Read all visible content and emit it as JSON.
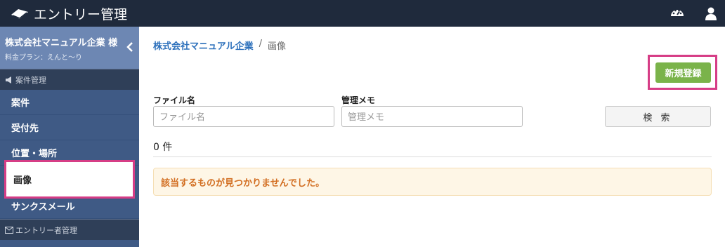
{
  "header": {
    "title": "エントリー管理",
    "dashboard_icon": "speedometer-icon",
    "user_icon": "user-icon"
  },
  "sidebar": {
    "account_name": "株式会社マニュアル企業 様",
    "plan": "料金プラン：えんと〜り",
    "sections": [
      {
        "label": "案件管理",
        "icon": "megaphone-icon"
      },
      {
        "label": "エントリー者管理",
        "icon": "mail-icon"
      }
    ],
    "items": [
      "案件",
      "受付先",
      "位置・場所",
      "画像",
      "サンクスメール"
    ]
  },
  "breadcrumb": {
    "parent": "株式会社マニュアル企業",
    "separator": "/",
    "current": "画像"
  },
  "new_button": "新規登録",
  "search": {
    "file_label": "ファイル名",
    "file_placeholder": "ファイル名",
    "memo_label": "管理メモ",
    "memo_placeholder": "管理メモ",
    "button": "検 索"
  },
  "count": "0 件",
  "message": "該当するものが見つかりませんでした。",
  "colors": {
    "topbar": "#1f2a3c",
    "sidebar": "#3f5a85",
    "accent": "#d63d86",
    "primary": "#7ab34a",
    "link": "#2b6fbb"
  }
}
